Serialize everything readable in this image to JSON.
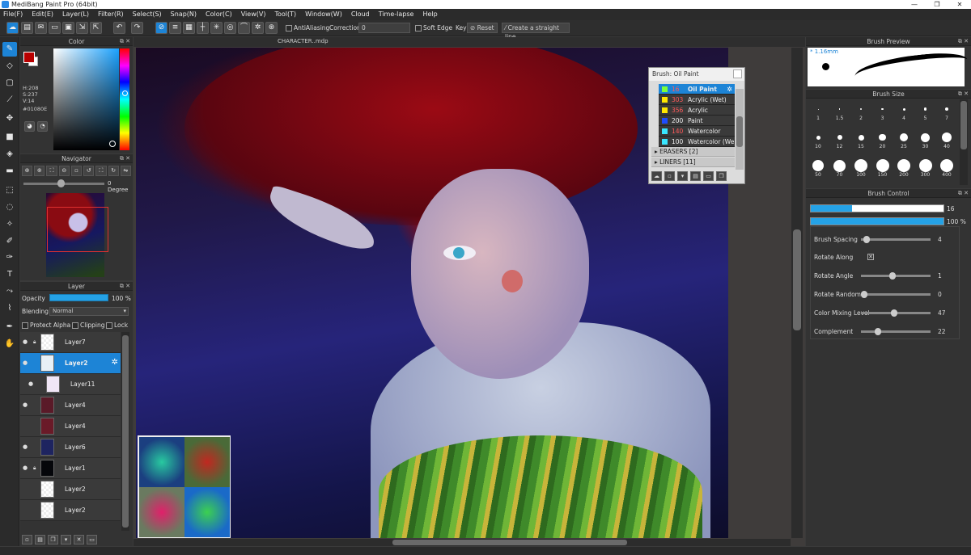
{
  "window": {
    "title": "MediBang Paint Pro (64bit)",
    "controls": [
      "—",
      "❐",
      "✕"
    ]
  },
  "menu": [
    "File(F)",
    "Edit(E)",
    "Layer(L)",
    "Filter(R)",
    "Select(S)",
    "Snap(N)",
    "Color(C)",
    "View(V)",
    "Tool(T)",
    "Window(W)",
    "Cloud",
    "Time-lapse",
    "Help"
  ],
  "toolbar": {
    "antialiasing_label": "AntiAliasing",
    "correction_label": "Correction",
    "correction_value": "0",
    "soft_edge_label": "Soft Edge",
    "key_label": "Key",
    "reset_label": "Reset",
    "straight_line_label": "Create a straight line"
  },
  "color_panel": {
    "title": "Color",
    "h": "H:208",
    "s": "S:237",
    "v": "V:14",
    "hex": "#01080E",
    "fg_color": "#b80000",
    "bg_color": "#ffffff"
  },
  "navigator": {
    "title": "Navigator",
    "degree": "0 Degree"
  },
  "layer_panel": {
    "title": "Layer",
    "opacity_label": "Opacity",
    "opacity_value": "100 %",
    "blending_label": "Blending",
    "blending_value": "Normal",
    "protect_alpha": "Protect Alpha",
    "clipping": "Clipping",
    "lock": "Lock",
    "layers": [
      {
        "name": "Layer7",
        "visible": true,
        "locked": true
      },
      {
        "name": "Layer2",
        "visible": true,
        "locked": false,
        "selected": true
      },
      {
        "name": "Layer11",
        "visible": true,
        "locked": false
      },
      {
        "name": "Layer4",
        "visible": true,
        "locked": false
      },
      {
        "name": "Layer4",
        "visible": false,
        "locked": false
      },
      {
        "name": "Layer6",
        "visible": true,
        "locked": false
      },
      {
        "name": "Layer1",
        "visible": true,
        "locked": true
      },
      {
        "name": "Layer2",
        "visible": false,
        "locked": false
      },
      {
        "name": "Layer2",
        "visible": false,
        "locked": false
      }
    ]
  },
  "canvas": {
    "doc_title": "CHARACTER..mdp"
  },
  "brush_popup": {
    "title": "Brush: Oil Paint",
    "items": [
      {
        "num": "16",
        "name": "Oil Paint",
        "color": "#7cff3a",
        "selected": true
      },
      {
        "num": "303",
        "name": "Acrylic (Wet)",
        "color": "#ffe600"
      },
      {
        "num": "356",
        "name": "Acrylic",
        "color": "#ffe600"
      },
      {
        "num": "200",
        "name": "Paint",
        "color": "#1e4cff"
      },
      {
        "num": "140",
        "name": "Watercolor",
        "color": "#39e6ff"
      },
      {
        "num": "100",
        "name": "Watercolor (We",
        "color": "#39e6ff"
      }
    ],
    "groups": [
      "ERASERS [2]",
      "LINERS [11]"
    ]
  },
  "brush_preview": {
    "title": "Brush Preview",
    "size_text": "* 1.16mm"
  },
  "brush_size": {
    "title": "Brush Size",
    "sizes": [
      "1",
      "1.5",
      "2",
      "3",
      "4",
      "5",
      "7",
      "10",
      "12",
      "15",
      "20",
      "25",
      "30",
      "40",
      "50",
      "70",
      "100",
      "150",
      "200",
      "300",
      "400"
    ]
  },
  "brush_control": {
    "title": "Brush Control",
    "size_value": "16",
    "opacity_value": "100 %",
    "size_fraction": 0.31,
    "opacity_fraction": 1.0,
    "rows": [
      {
        "label": "Brush Spacing",
        "value": "4",
        "fraction": 0.04
      },
      {
        "label": "Rotate Along",
        "checkbox": true
      },
      {
        "label": "Rotate Angle",
        "value": "1",
        "fraction": 0.45
      },
      {
        "label": "Rotate Random",
        "value": "0",
        "fraction": 0.0
      },
      {
        "label": "Color Mixing Level",
        "value": "47",
        "fraction": 0.47
      },
      {
        "label": "Complement",
        "value": "22",
        "fraction": 0.22
      }
    ]
  }
}
